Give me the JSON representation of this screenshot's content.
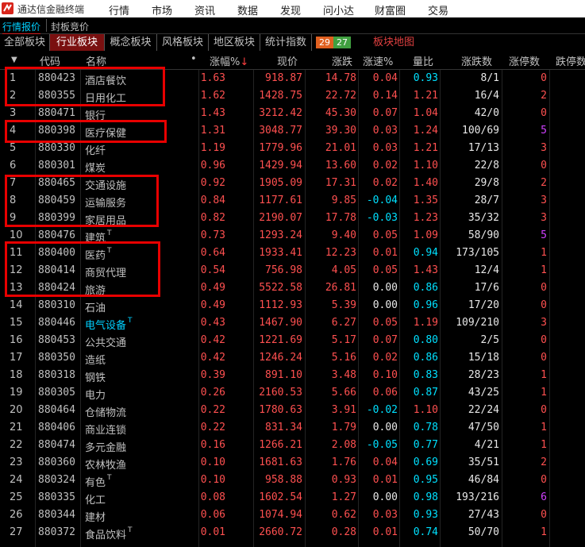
{
  "app": {
    "title": "通达信金融终端"
  },
  "menu": [
    "行情",
    "市场",
    "资讯",
    "数据",
    "发现",
    "问小达",
    "财富圈",
    "交易"
  ],
  "subtabs": {
    "quotes": "行情报价",
    "limit": "封板竞价"
  },
  "board_tabs": [
    "全部板块",
    "行业板块",
    "概念板块",
    "风格板块",
    "地区板块",
    "统计指数"
  ],
  "counts": {
    "up": "29",
    "down": "27"
  },
  "map_button": "板块地图",
  "header": {
    "sort": "▼",
    "code": "代码",
    "name": "名称",
    "dot": "•",
    "pct": "涨幅%",
    "pct_arrow": "↓",
    "price": "现价",
    "change": "涨跌",
    "speed": "涨速%",
    "volume_ratio": "量比",
    "updown": "涨跌数",
    "limit_up": "涨停数",
    "limit_down": "跌停数"
  },
  "rows": [
    {
      "idx": "1",
      "code": "880423",
      "name": "酒店餐饮",
      "t": "",
      "pct": "1.63",
      "price": "918.87",
      "chg": "14.78",
      "speed": "0.04",
      "vr": "0.93",
      "vr_color": "cyan2",
      "ud": "8/1",
      "zt": "0",
      "zt_color": "red",
      "speed_color": "red",
      "name_color": ""
    },
    {
      "idx": "2",
      "code": "880355",
      "name": "日用化工",
      "t": "",
      "pct": "1.62",
      "price": "1428.75",
      "chg": "22.72",
      "speed": "0.14",
      "vr": "1.21",
      "vr_color": "red",
      "ud": "16/4",
      "zt": "2",
      "zt_color": "red",
      "speed_color": "red",
      "name_color": ""
    },
    {
      "idx": "3",
      "code": "880471",
      "name": "银行",
      "t": "",
      "pct": "1.43",
      "price": "3212.42",
      "chg": "45.30",
      "speed": "0.07",
      "vr": "1.04",
      "vr_color": "red",
      "ud": "42/0",
      "zt": "0",
      "zt_color": "red",
      "speed_color": "red",
      "name_color": ""
    },
    {
      "idx": "4",
      "code": "880398",
      "name": "医疗保健",
      "t": "",
      "pct": "1.31",
      "price": "3048.77",
      "chg": "39.30",
      "speed": "0.03",
      "vr": "1.24",
      "vr_color": "red",
      "ud": "100/69",
      "zt": "5",
      "zt_color": "purple",
      "speed_color": "red",
      "name_color": ""
    },
    {
      "idx": "5",
      "code": "880330",
      "name": "化纤",
      "t": "",
      "pct": "1.19",
      "price": "1779.96",
      "chg": "21.01",
      "speed": "0.03",
      "vr": "1.21",
      "vr_color": "red",
      "ud": "17/13",
      "zt": "3",
      "zt_color": "red",
      "speed_color": "red",
      "name_color": ""
    },
    {
      "idx": "6",
      "code": "880301",
      "name": "煤炭",
      "t": "",
      "pct": "0.96",
      "price": "1429.94",
      "chg": "13.60",
      "speed": "0.02",
      "vr": "1.10",
      "vr_color": "red",
      "ud": "22/8",
      "zt": "0",
      "zt_color": "red",
      "speed_color": "red",
      "name_color": ""
    },
    {
      "idx": "7",
      "code": "880465",
      "name": "交通设施",
      "t": "",
      "pct": "0.92",
      "price": "1905.09",
      "chg": "17.31",
      "speed": "0.02",
      "vr": "1.40",
      "vr_color": "red",
      "ud": "29/8",
      "zt": "2",
      "zt_color": "red",
      "speed_color": "red",
      "name_color": ""
    },
    {
      "idx": "8",
      "code": "880459",
      "name": "运输服务",
      "t": "",
      "pct": "0.84",
      "price": "1177.61",
      "chg": "9.85",
      "speed": "-0.04",
      "vr": "1.35",
      "vr_color": "red",
      "ud": "28/7",
      "zt": "3",
      "zt_color": "red",
      "speed_color": "cyan2",
      "name_color": ""
    },
    {
      "idx": "9",
      "code": "880399",
      "name": "家居用品",
      "t": "",
      "pct": "0.82",
      "price": "2190.07",
      "chg": "17.78",
      "speed": "-0.03",
      "vr": "1.23",
      "vr_color": "red",
      "ud": "35/32",
      "zt": "3",
      "zt_color": "red",
      "speed_color": "cyan2",
      "name_color": ""
    },
    {
      "idx": "10",
      "code": "880476",
      "name": "建筑",
      "t": "T",
      "pct": "0.73",
      "price": "1293.24",
      "chg": "9.40",
      "speed": "0.05",
      "vr": "1.09",
      "vr_color": "red",
      "ud": "58/90",
      "zt": "5",
      "zt_color": "purple",
      "speed_color": "red",
      "name_color": ""
    },
    {
      "idx": "11",
      "code": "880400",
      "name": "医药",
      "t": "T",
      "pct": "0.64",
      "price": "1933.41",
      "chg": "12.23",
      "speed": "0.01",
      "vr": "0.94",
      "vr_color": "cyan2",
      "ud": "173/105",
      "zt": "1",
      "zt_color": "red",
      "speed_color": "red",
      "name_color": ""
    },
    {
      "idx": "12",
      "code": "880414",
      "name": "商贸代理",
      "t": "",
      "pct": "0.54",
      "price": "756.98",
      "chg": "4.05",
      "speed": "0.05",
      "vr": "1.43",
      "vr_color": "red",
      "ud": "12/4",
      "zt": "1",
      "zt_color": "red",
      "speed_color": "red",
      "name_color": ""
    },
    {
      "idx": "13",
      "code": "880424",
      "name": "旅游",
      "t": "",
      "pct": "0.49",
      "price": "5522.58",
      "chg": "26.81",
      "speed": "0.00",
      "vr": "0.86",
      "vr_color": "cyan2",
      "ud": "17/6",
      "zt": "0",
      "zt_color": "red",
      "speed_color": "white",
      "name_color": ""
    },
    {
      "idx": "14",
      "code": "880310",
      "name": "石油",
      "t": "",
      "pct": "0.49",
      "price": "1112.93",
      "chg": "5.39",
      "speed": "0.00",
      "vr": "0.96",
      "vr_color": "cyan2",
      "ud": "17/20",
      "zt": "0",
      "zt_color": "red",
      "speed_color": "white",
      "name_color": ""
    },
    {
      "idx": "15",
      "code": "880446",
      "name": "电气设备",
      "t": "T",
      "pct": "0.43",
      "price": "1467.90",
      "chg": "6.27",
      "speed": "0.05",
      "vr": "1.19",
      "vr_color": "red",
      "ud": "109/210",
      "zt": "3",
      "zt_color": "red",
      "speed_color": "red",
      "name_color": "cyan"
    },
    {
      "idx": "16",
      "code": "880453",
      "name": "公共交通",
      "t": "",
      "pct": "0.42",
      "price": "1221.69",
      "chg": "5.17",
      "speed": "0.07",
      "vr": "0.80",
      "vr_color": "cyan2",
      "ud": "2/5",
      "zt": "0",
      "zt_color": "red",
      "speed_color": "red",
      "name_color": ""
    },
    {
      "idx": "17",
      "code": "880350",
      "name": "造纸",
      "t": "",
      "pct": "0.42",
      "price": "1246.24",
      "chg": "5.16",
      "speed": "0.02",
      "vr": "0.86",
      "vr_color": "cyan2",
      "ud": "15/18",
      "zt": "0",
      "zt_color": "red",
      "speed_color": "red",
      "name_color": ""
    },
    {
      "idx": "18",
      "code": "880318",
      "name": "钢铁",
      "t": "",
      "pct": "0.39",
      "price": "891.10",
      "chg": "3.48",
      "speed": "0.10",
      "vr": "0.83",
      "vr_color": "cyan2",
      "ud": "28/23",
      "zt": "1",
      "zt_color": "red",
      "speed_color": "red",
      "name_color": ""
    },
    {
      "idx": "19",
      "code": "880305",
      "name": "电力",
      "t": "",
      "pct": "0.26",
      "price": "2160.53",
      "chg": "5.66",
      "speed": "0.06",
      "vr": "0.87",
      "vr_color": "cyan2",
      "ud": "43/25",
      "zt": "1",
      "zt_color": "red",
      "speed_color": "red",
      "name_color": ""
    },
    {
      "idx": "20",
      "code": "880464",
      "name": "仓储物流",
      "t": "",
      "pct": "0.22",
      "price": "1780.63",
      "chg": "3.91",
      "speed": "-0.02",
      "vr": "1.10",
      "vr_color": "red",
      "ud": "22/24",
      "zt": "0",
      "zt_color": "red",
      "speed_color": "cyan2",
      "name_color": ""
    },
    {
      "idx": "21",
      "code": "880406",
      "name": "商业连锁",
      "t": "",
      "pct": "0.22",
      "price": "831.34",
      "chg": "1.79",
      "speed": "0.00",
      "vr": "0.78",
      "vr_color": "cyan2",
      "ud": "47/50",
      "zt": "1",
      "zt_color": "red",
      "speed_color": "white",
      "name_color": ""
    },
    {
      "idx": "22",
      "code": "880474",
      "name": "多元金融",
      "t": "",
      "pct": "0.16",
      "price": "1266.21",
      "chg": "2.08",
      "speed": "-0.05",
      "vr": "0.77",
      "vr_color": "cyan2",
      "ud": "4/21",
      "zt": "1",
      "zt_color": "red",
      "speed_color": "cyan2",
      "name_color": ""
    },
    {
      "idx": "23",
      "code": "880360",
      "name": "农林牧渔",
      "t": "",
      "pct": "0.10",
      "price": "1681.63",
      "chg": "1.76",
      "speed": "0.04",
      "vr": "0.69",
      "vr_color": "cyan2",
      "ud": "35/51",
      "zt": "2",
      "zt_color": "red",
      "speed_color": "red",
      "name_color": ""
    },
    {
      "idx": "24",
      "code": "880324",
      "name": "有色",
      "t": "T",
      "pct": "0.10",
      "price": "958.88",
      "chg": "0.93",
      "speed": "0.01",
      "vr": "0.95",
      "vr_color": "cyan2",
      "ud": "46/84",
      "zt": "0",
      "zt_color": "red",
      "speed_color": "red",
      "name_color": ""
    },
    {
      "idx": "25",
      "code": "880335",
      "name": "化工",
      "t": "",
      "pct": "0.08",
      "price": "1602.54",
      "chg": "1.27",
      "speed": "0.00",
      "vr": "0.98",
      "vr_color": "cyan2",
      "ud": "193/216",
      "zt": "6",
      "zt_color": "purple",
      "speed_color": "white",
      "name_color": ""
    },
    {
      "idx": "26",
      "code": "880344",
      "name": "建材",
      "t": "",
      "pct": "0.06",
      "price": "1074.94",
      "chg": "0.62",
      "speed": "0.03",
      "vr": "0.93",
      "vr_color": "cyan2",
      "ud": "27/43",
      "zt": "0",
      "zt_color": "red",
      "speed_color": "red",
      "name_color": ""
    },
    {
      "idx": "27",
      "code": "880372",
      "name": "食品饮料",
      "t": "T",
      "pct": "0.01",
      "price": "2660.72",
      "chg": "0.28",
      "speed": "0.01",
      "vr": "0.74",
      "vr_color": "cyan2",
      "ud": "50/70",
      "zt": "1",
      "zt_color": "red",
      "speed_color": "red",
      "name_color": ""
    }
  ],
  "colors": {
    "up": "#ff5050",
    "down": "#00e0ff",
    "highlight_box": "#e80000",
    "active_tab": "#7a1010"
  }
}
